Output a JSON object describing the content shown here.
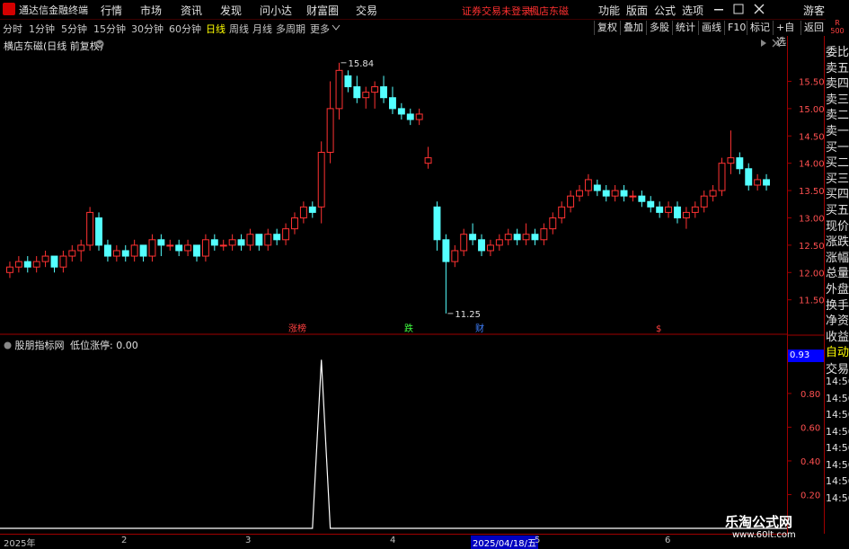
{
  "app": {
    "title": "通达信金融终端",
    "logo_icon": "tdx-logo-icon"
  },
  "menu": {
    "items": [
      "行情",
      "市场",
      "资讯",
      "发现",
      "问小达",
      "财富圈",
      "交易"
    ],
    "notice": "证券交易未登录",
    "stock": "楓店东磁",
    "right": [
      "功能",
      "版面",
      "公式",
      "选项"
    ],
    "guest": "游客"
  },
  "periods": [
    "分时",
    "1分钟",
    "5分钟",
    "15分钟",
    "30分钟",
    "60分钟",
    "日线",
    "周线",
    "月线",
    "多周期",
    "更多"
  ],
  "active_period": "日线",
  "toolbar": [
    "复权",
    "叠加",
    "多股",
    "统计",
    "画线",
    "F10",
    "标记",
    "+自选",
    "返回"
  ],
  "corner_badge": {
    "line1": "R",
    "line2": "500"
  },
  "main": {
    "title": "横店东磁(日线 前复权)",
    "high_label": "15.84",
    "low_label": "11.25",
    "markers": [
      {
        "label": "涨榜",
        "color": "#ff4040"
      },
      {
        "label": "跌",
        "color": "#40ff40"
      },
      {
        "label": "财",
        "color": "#4080ff"
      },
      {
        "label": "$",
        "color": "#ff4040"
      }
    ]
  },
  "indicator": {
    "title": "股朋指标网",
    "name": "低位涨停",
    "value": "0.00",
    "current": "0.93"
  },
  "side_panel": [
    "委比",
    "卖五",
    "卖四",
    "卖三",
    "卖二",
    "卖一",
    "买一",
    "买二",
    "买三",
    "买四",
    "买五",
    "现价",
    "涨跌",
    "涨幅",
    "总量",
    "外盘",
    "换手",
    "净资",
    "收益",
    "自动",
    "交易",
    "14:56",
    "14:56",
    "14:56",
    "14:56",
    "14:56",
    "14:56",
    "14:56",
    "14:56"
  ],
  "date_axis": [
    "2025年",
    "2",
    "3",
    "4",
    "2025/04/18/五",
    "5",
    "6"
  ],
  "watermark": {
    "line1": "乐淘公式网",
    "line2": "www.60lt.com"
  },
  "colors": {
    "up": "#ff3232",
    "down": "#54ffff",
    "bg": "#000000",
    "grid": "#a00000",
    "axis_text": "#ff5050"
  },
  "chart_data": [
    {
      "type": "candlestick",
      "title": "横店东磁(日线 前复权)",
      "y_ticks": [
        11.5,
        12.0,
        12.5,
        13.0,
        13.5,
        14.0,
        14.5,
        15.0,
        15.5
      ],
      "ylim": [
        11.1,
        16.1
      ],
      "candles": [
        [
          12.0,
          12.2,
          11.9,
          12.1
        ],
        [
          12.1,
          12.3,
          12.0,
          12.2
        ],
        [
          12.2,
          12.3,
          12.0,
          12.1
        ],
        [
          12.1,
          12.3,
          12.0,
          12.2
        ],
        [
          12.2,
          12.4,
          12.1,
          12.3
        ],
        [
          12.3,
          12.3,
          12.0,
          12.1
        ],
        [
          12.1,
          12.4,
          12.0,
          12.3
        ],
        [
          12.3,
          12.5,
          12.2,
          12.4
        ],
        [
          12.4,
          12.6,
          12.2,
          12.5
        ],
        [
          12.5,
          13.2,
          12.4,
          13.1
        ],
        [
          13.0,
          13.1,
          12.4,
          12.5
        ],
        [
          12.5,
          12.6,
          12.2,
          12.3
        ],
        [
          12.3,
          12.5,
          12.2,
          12.4
        ],
        [
          12.4,
          12.5,
          12.2,
          12.3
        ],
        [
          12.3,
          12.6,
          12.2,
          12.5
        ],
        [
          12.5,
          12.5,
          12.2,
          12.3
        ],
        [
          12.3,
          12.7,
          12.2,
          12.6
        ],
        [
          12.6,
          12.7,
          12.3,
          12.5
        ],
        [
          12.5,
          12.6,
          12.4,
          12.5
        ],
        [
          12.5,
          12.6,
          12.3,
          12.4
        ],
        [
          12.4,
          12.6,
          12.3,
          12.5
        ],
        [
          12.5,
          12.5,
          12.2,
          12.3
        ],
        [
          12.3,
          12.7,
          12.2,
          12.6
        ],
        [
          12.6,
          12.7,
          12.4,
          12.5
        ],
        [
          12.5,
          12.6,
          12.4,
          12.5
        ],
        [
          12.5,
          12.7,
          12.4,
          12.6
        ],
        [
          12.6,
          12.7,
          12.4,
          12.5
        ],
        [
          12.5,
          12.8,
          12.4,
          12.7
        ],
        [
          12.7,
          12.7,
          12.4,
          12.5
        ],
        [
          12.5,
          12.8,
          12.4,
          12.7
        ],
        [
          12.7,
          12.8,
          12.5,
          12.6
        ],
        [
          12.6,
          12.9,
          12.5,
          12.8
        ],
        [
          12.8,
          13.1,
          12.7,
          13.0
        ],
        [
          13.0,
          13.3,
          12.9,
          13.2
        ],
        [
          13.2,
          13.3,
          13.0,
          13.1
        ],
        [
          13.2,
          14.4,
          12.9,
          14.2
        ],
        [
          14.2,
          15.5,
          14.0,
          15.0
        ],
        [
          15.0,
          15.84,
          14.8,
          15.7
        ],
        [
          15.6,
          15.7,
          15.3,
          15.4
        ],
        [
          15.4,
          15.6,
          15.1,
          15.2
        ],
        [
          15.2,
          15.4,
          15.0,
          15.3
        ],
        [
          15.3,
          15.5,
          15.0,
          15.4
        ],
        [
          15.4,
          15.6,
          15.1,
          15.2
        ],
        [
          15.2,
          15.4,
          14.9,
          15.0
        ],
        [
          15.0,
          15.1,
          14.8,
          14.9
        ],
        [
          14.9,
          15.0,
          14.7,
          14.8
        ],
        [
          14.8,
          15.0,
          14.7,
          14.9
        ],
        [
          14.0,
          14.3,
          13.9,
          14.1
        ],
        [
          13.2,
          13.3,
          12.4,
          12.6
        ],
        [
          12.6,
          12.7,
          11.25,
          12.2
        ],
        [
          12.2,
          12.5,
          12.1,
          12.4
        ],
        [
          12.4,
          12.8,
          12.3,
          12.7
        ],
        [
          12.7,
          12.9,
          12.5,
          12.6
        ],
        [
          12.6,
          12.7,
          12.3,
          12.4
        ],
        [
          12.4,
          12.6,
          12.3,
          12.5
        ],
        [
          12.5,
          12.7,
          12.4,
          12.6
        ],
        [
          12.6,
          12.8,
          12.5,
          12.7
        ],
        [
          12.7,
          12.8,
          12.5,
          12.6
        ],
        [
          12.6,
          12.9,
          12.5,
          12.7
        ],
        [
          12.7,
          12.8,
          12.5,
          12.6
        ],
        [
          12.6,
          12.9,
          12.5,
          12.8
        ],
        [
          12.8,
          13.1,
          12.7,
          13.0
        ],
        [
          13.0,
          13.3,
          12.9,
          13.2
        ],
        [
          13.2,
          13.5,
          13.1,
          13.4
        ],
        [
          13.4,
          13.6,
          13.3,
          13.5
        ],
        [
          13.5,
          13.8,
          13.4,
          13.7
        ],
        [
          13.6,
          13.7,
          13.4,
          13.5
        ],
        [
          13.5,
          13.6,
          13.3,
          13.4
        ],
        [
          13.4,
          13.6,
          13.3,
          13.5
        ],
        [
          13.5,
          13.6,
          13.3,
          13.4
        ],
        [
          13.4,
          13.5,
          13.3,
          13.4
        ],
        [
          13.4,
          13.5,
          13.2,
          13.3
        ],
        [
          13.3,
          13.4,
          13.1,
          13.2
        ],
        [
          13.2,
          13.3,
          13.0,
          13.1
        ],
        [
          13.1,
          13.3,
          13.0,
          13.2
        ],
        [
          13.2,
          13.3,
          12.9,
          13.0
        ],
        [
          13.0,
          13.2,
          12.8,
          13.1
        ],
        [
          13.1,
          13.3,
          13.0,
          13.2
        ],
        [
          13.2,
          13.5,
          13.1,
          13.4
        ],
        [
          13.4,
          13.6,
          13.3,
          13.5
        ],
        [
          13.5,
          14.1,
          13.4,
          14.0
        ],
        [
          14.0,
          14.6,
          13.8,
          14.1
        ],
        [
          14.1,
          14.2,
          13.8,
          13.9
        ],
        [
          13.9,
          14.0,
          13.5,
          13.6
        ],
        [
          13.6,
          13.8,
          13.5,
          13.7
        ],
        [
          13.7,
          13.8,
          13.5,
          13.6
        ]
      ]
    },
    {
      "type": "line",
      "title": "低位涨停",
      "y_ticks": [
        0.2,
        0.4,
        0.6,
        0.8
      ],
      "ylim": [
        0,
        1.05
      ],
      "spike_index": 35,
      "spike_value": 1.0
    }
  ]
}
